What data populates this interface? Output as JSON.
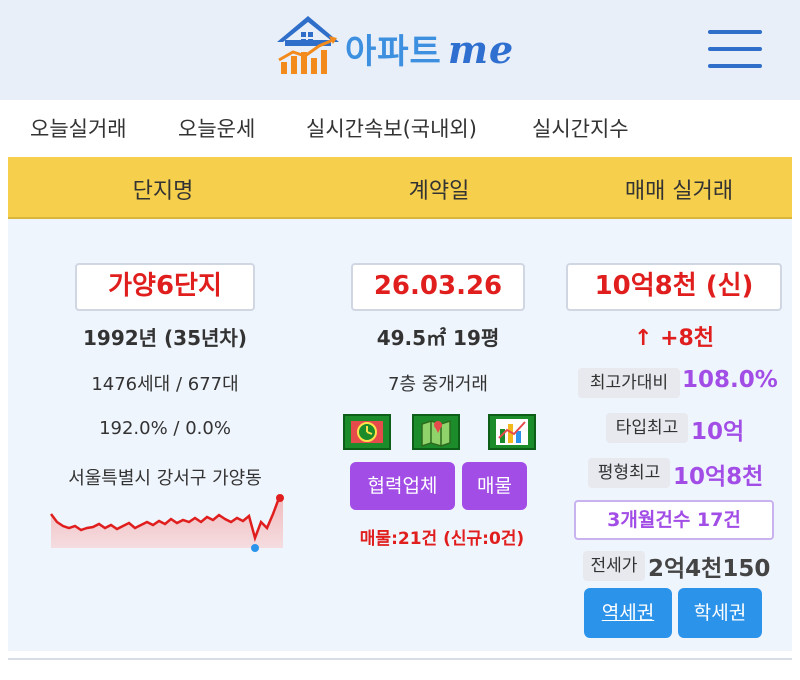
{
  "header": {
    "logo_text": "아파트",
    "logo_me": "me"
  },
  "nav": {
    "items": [
      "오늘실거래",
      "오늘운세",
      "실시간속보(국내외)",
      "실시간지수"
    ]
  },
  "table": {
    "columns": [
      "단지명",
      "계약일",
      "매매 실거래"
    ]
  },
  "row": {
    "complex": {
      "name": "가양6단지",
      "built": "1992년 (35년차)",
      "units": "1476세대 / 677대",
      "ratio": "192.0% / 0.0%",
      "address": "서울특별시 강서구 가양동"
    },
    "contract": {
      "date": "26.03.26",
      "area_m2": "49.5㎡",
      "area_py": "19평",
      "floor_info": "7층 중개거래",
      "partner_button": "협력업체",
      "listings_button": "매물",
      "listings_count": "매물:21건 (신규:0건)"
    },
    "trade": {
      "price": "10억8천 (신)",
      "change_arrow": "↑",
      "change": "+8천",
      "high_ratio_label": "최고가대비",
      "high_ratio_value": "108.0%",
      "type_high_label": "타입최고",
      "type_high_value": "10억",
      "area_high_label": "평형최고",
      "area_high_value": "10억8천",
      "three_month_count": "3개월건수 17건",
      "jeonse_label": "전세가",
      "jeonse_value": "2억4천150",
      "station_button": "역세권",
      "school_button": "학세권"
    }
  },
  "colors": {
    "header_bg": "#e8eff9",
    "table_head_bg": "#f6cf4c",
    "panel_bg": "#eff5fd",
    "price_red": "#e01e1e",
    "purple": "#a24ee6",
    "blue": "#2c93ea"
  },
  "icons": {
    "logo": "house-chart-icon",
    "menu": "hamburger-menu-icon",
    "alarm": "alarm-clock-icon",
    "map": "map-pin-icon",
    "chart": "bar-chart-icon"
  }
}
